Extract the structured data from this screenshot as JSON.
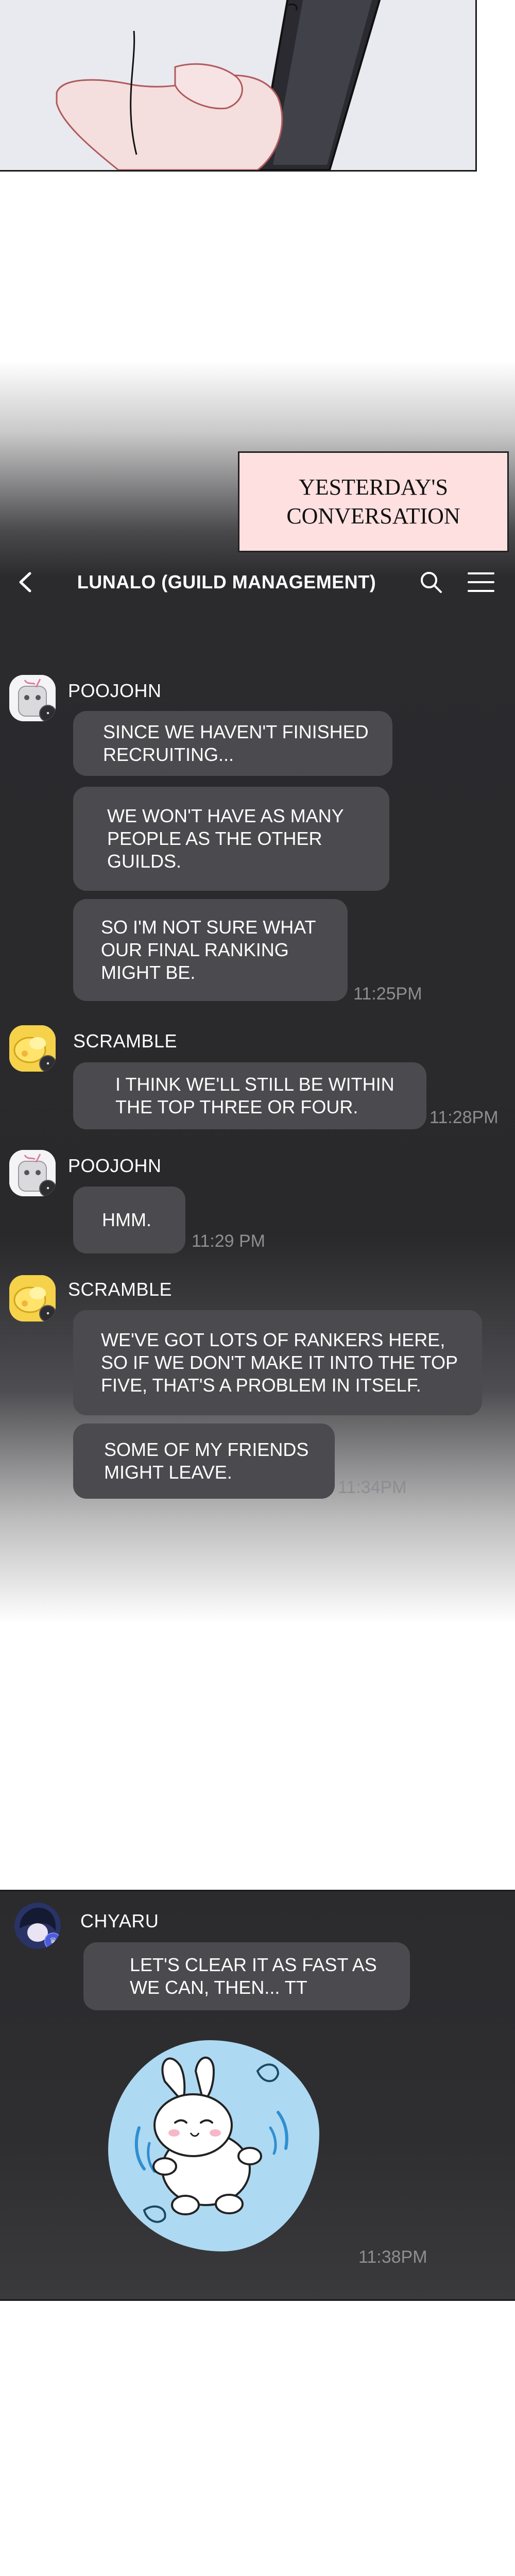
{
  "caption": "YESTERDAY'S\nCONVERSATION",
  "header": {
    "title": "LUNALO (GUILD MANAGEMENT)"
  },
  "messages": [
    {
      "sender": "POOJOHN",
      "text": "SINCE WE HAVEN'T FINISHED\nRECRUITING..."
    },
    {
      "text": "WE WON'T HAVE AS MANY\nPEOPLE AS THE OTHER\nGUILDS."
    },
    {
      "text": "SO I'M NOT SURE WHAT\nOUR FINAL RANKING\nMIGHT BE.",
      "time": "11:25PM"
    },
    {
      "sender": "SCRAMBLE",
      "text": "I THINK WE'LL STILL BE WITHIN\nTHE TOP THREE OR FOUR.",
      "time": "11:28PM"
    },
    {
      "sender": "POOJOHN",
      "text": "HMM.",
      "time": "11:29 PM"
    },
    {
      "sender": "SCRAMBLE",
      "text": "WE'VE GOT LOTS OF RANKERS HERE,\nSO IF WE DON'T MAKE IT INTO THE TOP\nFIVE, THAT'S A PROBLEM IN ITSELF."
    },
    {
      "text": "SOME OF MY FRIENDS\nMIGHT LEAVE.",
      "time": "11:34PM"
    },
    {
      "sender": "CHYARU",
      "text": "LET'S CLEAR IT AS FAST AS\nWE CAN, THEN... TT"
    },
    {
      "time": "11:38PM"
    }
  ],
  "icons": {
    "back": "chevron-left-icon",
    "search": "search-icon",
    "menu": "hamburger-menu-icon",
    "sticker": "bunny-sticker-icon"
  },
  "colors": {
    "bubble": "#4b4b4f",
    "chat_background": "#29292c",
    "caption_box": "#ffe0e0",
    "timestamp": "#8d8d92",
    "sticker_background": "#aed9f2"
  }
}
